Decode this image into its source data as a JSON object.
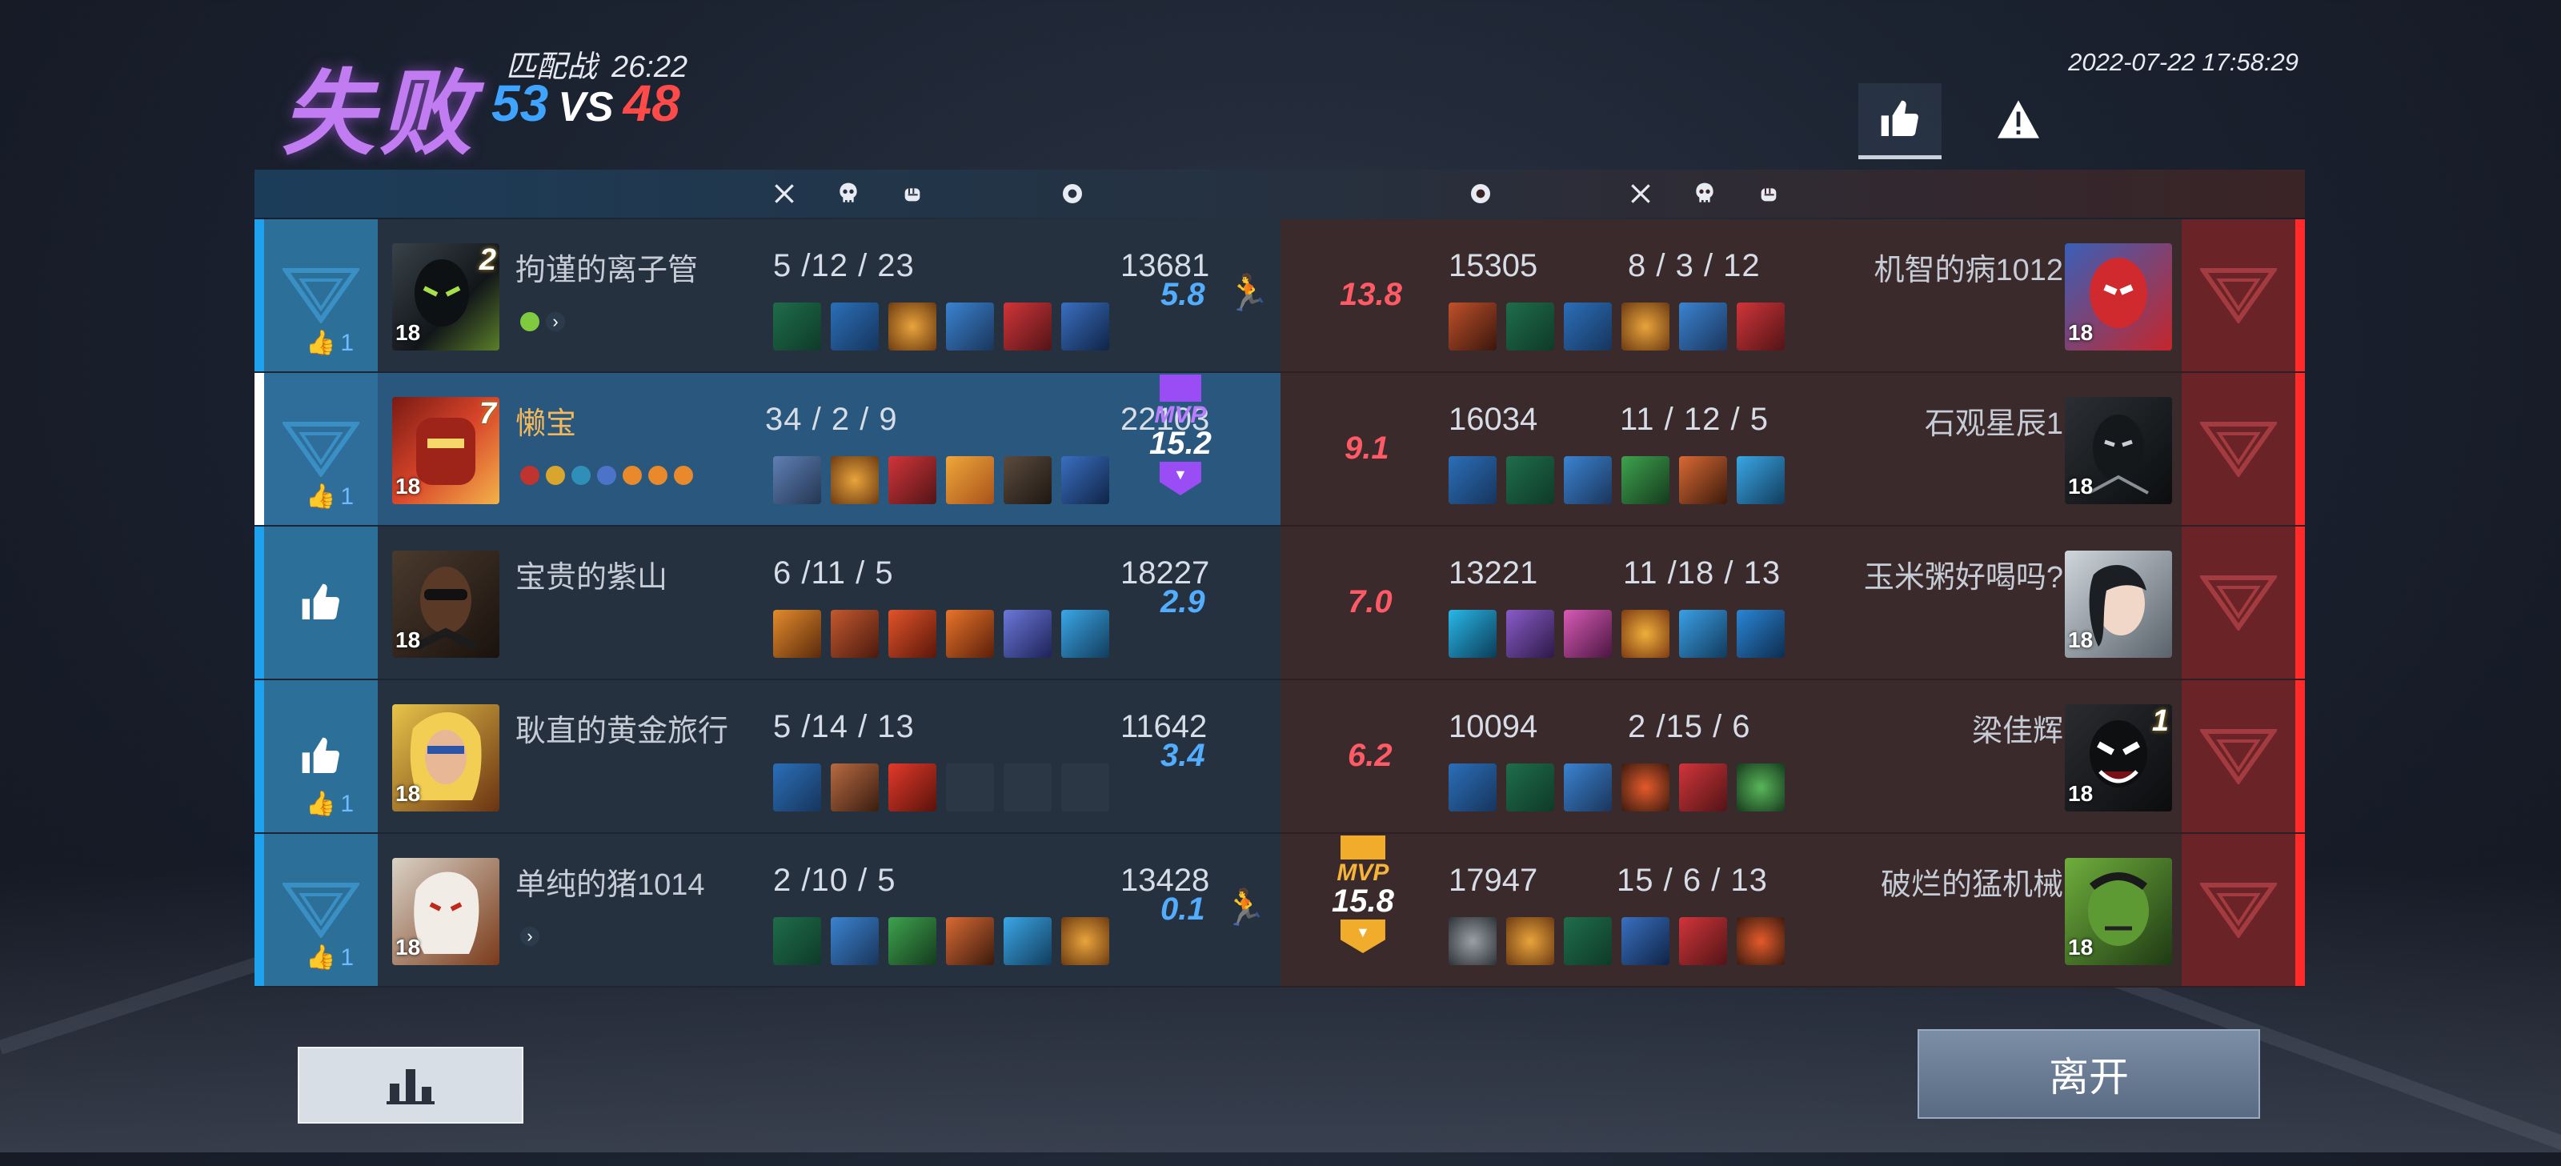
{
  "header": {
    "result": "失败",
    "mode": "匹配战",
    "duration": "26:22",
    "score_ours": "53",
    "score_vs": "VS",
    "score_theirs": "48",
    "datetime": "2022-07-22 17:58:29"
  },
  "columns": {
    "kills_icon": "crossed-swords-icon",
    "deaths_icon": "skull-icon",
    "assists_icon": "fist-icon",
    "gold_icon": "coin-icon"
  },
  "mvp_label": "MVP",
  "left_team": [
    {
      "name": "拘谨的离子管",
      "level": "18",
      "badge": "2",
      "kda": "5  /12 / 23",
      "gold": "13681",
      "rating": "5.8",
      "likes": "1",
      "mvp": false,
      "is_me": false
    },
    {
      "name": "懒宝",
      "level": "18",
      "badge": "7",
      "kda": "34  /  2  /  9",
      "gold": "22103",
      "rating": "15.2",
      "likes": "1",
      "mvp": true,
      "is_me": true
    },
    {
      "name": "宝贵的紫山",
      "level": "18",
      "badge": "",
      "kda": "6  /11 /  5",
      "gold": "18227",
      "rating": "2.9",
      "likes": "",
      "mvp": false,
      "is_me": false
    },
    {
      "name": "耿直的黄金旅行",
      "level": "18",
      "badge": "",
      "kda": "5  /14 / 13",
      "gold": "11642",
      "rating": "3.4",
      "likes": "1",
      "mvp": false,
      "is_me": false
    },
    {
      "name": "单纯的猪1014",
      "level": "18",
      "badge": "",
      "kda": "2  /10 /  5",
      "gold": "13428",
      "rating": "0.1",
      "likes": "1",
      "mvp": false,
      "is_me": false
    }
  ],
  "right_team": [
    {
      "name": "机智的病1012",
      "level": "18",
      "badge": "",
      "kda": "8  /  3  / 12",
      "gold": "15305",
      "rating": "13.8",
      "mvp": false
    },
    {
      "name": "石观星辰1",
      "level": "18",
      "badge": "",
      "kda": "11  / 12 /  5",
      "gold": "16034",
      "rating": "9.1",
      "mvp": false
    },
    {
      "name": "玉米粥好喝吗?",
      "level": "18",
      "badge": "",
      "kda": "11  /18 / 13",
      "gold": "13221",
      "rating": "7.0",
      "mvp": false
    },
    {
      "name": "梁佳辉",
      "level": "18",
      "badge": "1",
      "kda": "2  /15 /  6",
      "gold": "10094",
      "rating": "6.2",
      "mvp": false
    },
    {
      "name": "破烂的猛机械",
      "level": "18",
      "badge": "",
      "kda": "15  /  6  / 13",
      "gold": "17947",
      "rating": "15.8",
      "mvp": true
    }
  ],
  "footer": {
    "stats_icon": "bar-chart-icon",
    "leave_label": "离开"
  },
  "colors": {
    "blue_team": "#1ea2ee",
    "red_team": "#ff2a2a",
    "mvp_purple": "#9b4df5",
    "mvp_gold": "#f2ac2c",
    "defeat_purple": "#c07cf0"
  }
}
